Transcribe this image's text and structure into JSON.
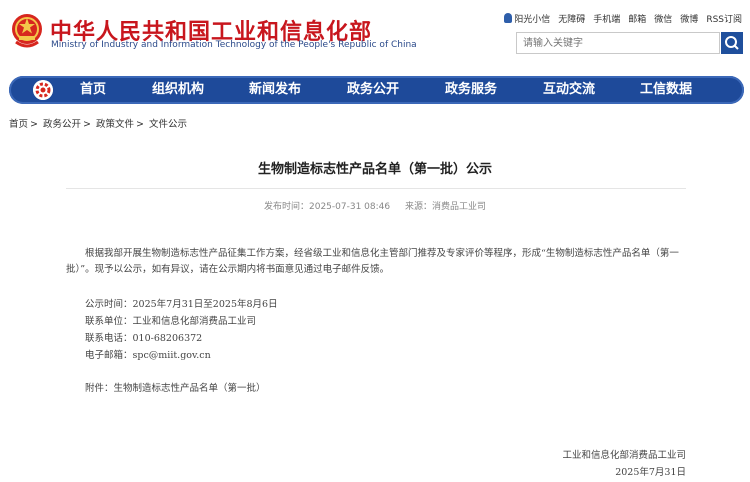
{
  "header": {
    "title_cn": "中华人民共和国工业和信息化部",
    "title_en": "Ministry of Industry and Information Technology of the People's Republic of China",
    "top_links": [
      "阳光小信",
      "无障碍",
      "手机端",
      "邮箱",
      "微信",
      "微博",
      "RSS订阅"
    ],
    "search_placeholder": "请输入关键字"
  },
  "nav": {
    "items": [
      "首页",
      "组织机构",
      "新闻发布",
      "政务公开",
      "政务服务",
      "互动交流",
      "工信数据"
    ]
  },
  "breadcrumb": [
    "首页",
    "政务公开",
    "政策文件",
    "文件公示"
  ],
  "article": {
    "title": "生物制造标志性产品名单（第一批）公示",
    "publish_time": "发布时间：2025-07-31 08:46",
    "source": "来源：消费品工业司",
    "paragraph": "根据我部开展生物制造标志性产品征集工作方案，经省级工业和信息化主管部门推荐及专家评价等程序，形成“生物制造标志性产品名单（第一批）”。现予以公示，如有异议，请在公示期内将书面意见通过电子邮件反馈。",
    "lines": [
      "公示时间：2025年7月31日至2025年8月6日",
      "联系单位：工业和信息化部消费品工业司",
      "联系电话：010-68206372",
      "电子邮箱：spc@miit.gov.cn"
    ],
    "attachment": "附件：生物制造标志性产品名单（第一批）",
    "signature": "工业和信息化部消费品工业司",
    "date": "2025年7月31日"
  },
  "colors": {
    "brand_red": "#c8161d",
    "nav_blue": "#1e4a9a"
  }
}
